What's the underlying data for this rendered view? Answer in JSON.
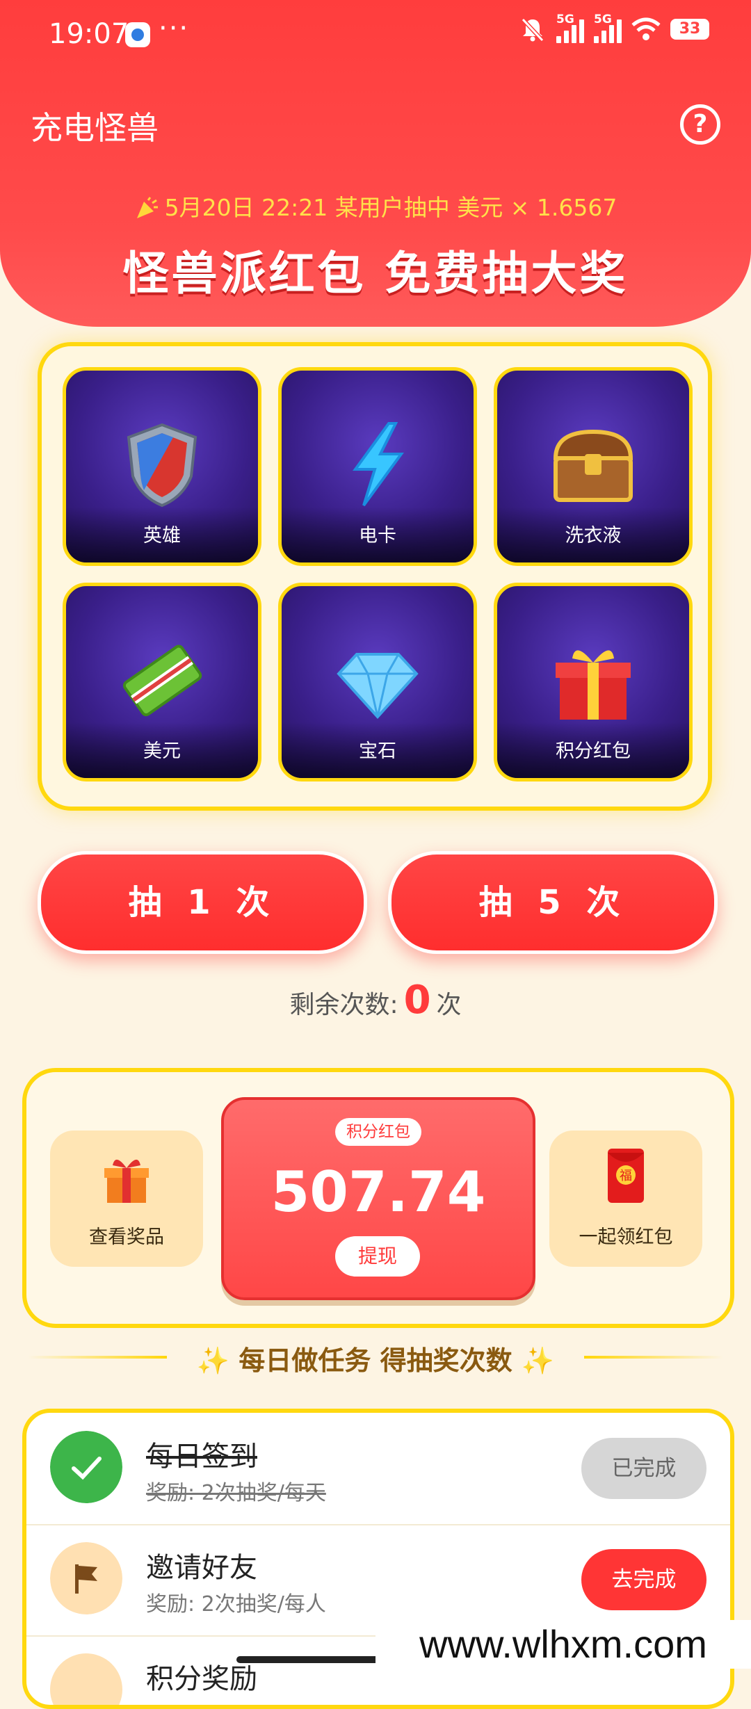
{
  "status_bar": {
    "time": "19:07",
    "dots": "···",
    "signal_label": "5G",
    "battery": "33"
  },
  "header": {
    "title": "充电怪兽",
    "ticker": "5月20日 22:21 某用户抽中 美元 × 1.6567",
    "headline": "怪兽派红包 免费抽大奖"
  },
  "prizes": [
    {
      "label": "英雄",
      "icon": "shield-icon"
    },
    {
      "label": "电卡",
      "icon": "lightning-icon"
    },
    {
      "label": "洗衣液",
      "icon": "treasure-chest-icon"
    },
    {
      "label": "美元",
      "icon": "cash-icon"
    },
    {
      "label": "宝石",
      "icon": "diamond-icon"
    },
    {
      "label": "积分红包",
      "icon": "gift-box-icon"
    }
  ],
  "draw": {
    "once_label": "抽 1 次",
    "five_label": "抽 5 次",
    "remaining_prefix": "剩余次数:",
    "remaining_count": "0",
    "remaining_suffix": "次"
  },
  "wallet": {
    "view_prizes_label": "查看奖品",
    "points_tag": "积分红包",
    "points_value": "507.74",
    "withdraw_label": "提现",
    "share_label": "一起领红包",
    "envelope_char": "福"
  },
  "tasks": {
    "title": "每日做任务 得抽奖次数",
    "items": [
      {
        "title": "每日签到",
        "reward": "奖励: 2次抽奖/每天",
        "button": "已完成",
        "done": true
      },
      {
        "title": "邀请好友",
        "reward": "奖励: 2次抽奖/每人",
        "button": "去完成",
        "done": false
      },
      {
        "title": "积分奖励",
        "reward": "",
        "button": "",
        "done": false
      }
    ]
  },
  "watermark": "www.wlhxm.com",
  "colors": {
    "primary_red": "#ff3d3d",
    "gold": "#ffd80f",
    "green_done": "#3db54a",
    "bg": "#fdf4e3"
  }
}
